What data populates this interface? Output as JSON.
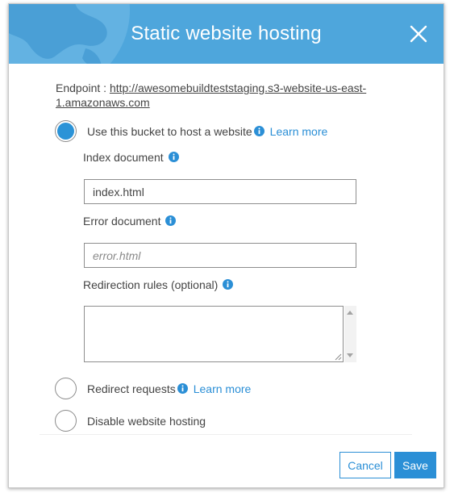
{
  "dialog": {
    "title": "Static website hosting"
  },
  "endpoint": {
    "label": "Endpoint : ",
    "url": "http://awesomebuildteststaging.s3-website-us-east-1.amazonaws.com"
  },
  "options": {
    "host_website": {
      "label": "Use this bucket to host a website",
      "learn_more": "Learn more",
      "selected": true
    },
    "redirect_requests": {
      "label": "Redirect requests",
      "learn_more": "Learn more",
      "selected": false
    },
    "disable_hosting": {
      "label": "Disable website hosting",
      "selected": false
    }
  },
  "fields": {
    "index_document": {
      "label": "Index document",
      "value": "index.html"
    },
    "error_document": {
      "label": "Error document",
      "value": "",
      "placeholder": "error.html"
    },
    "redirection_rules": {
      "label": "Redirection rules (optional)",
      "value": ""
    }
  },
  "buttons": {
    "cancel": "Cancel",
    "save": "Save"
  },
  "colors": {
    "header": "#4ea6dc",
    "accent": "#2b8fd6",
    "text": "#444444"
  },
  "icons": {
    "close": "close-icon",
    "info": "info-icon"
  }
}
